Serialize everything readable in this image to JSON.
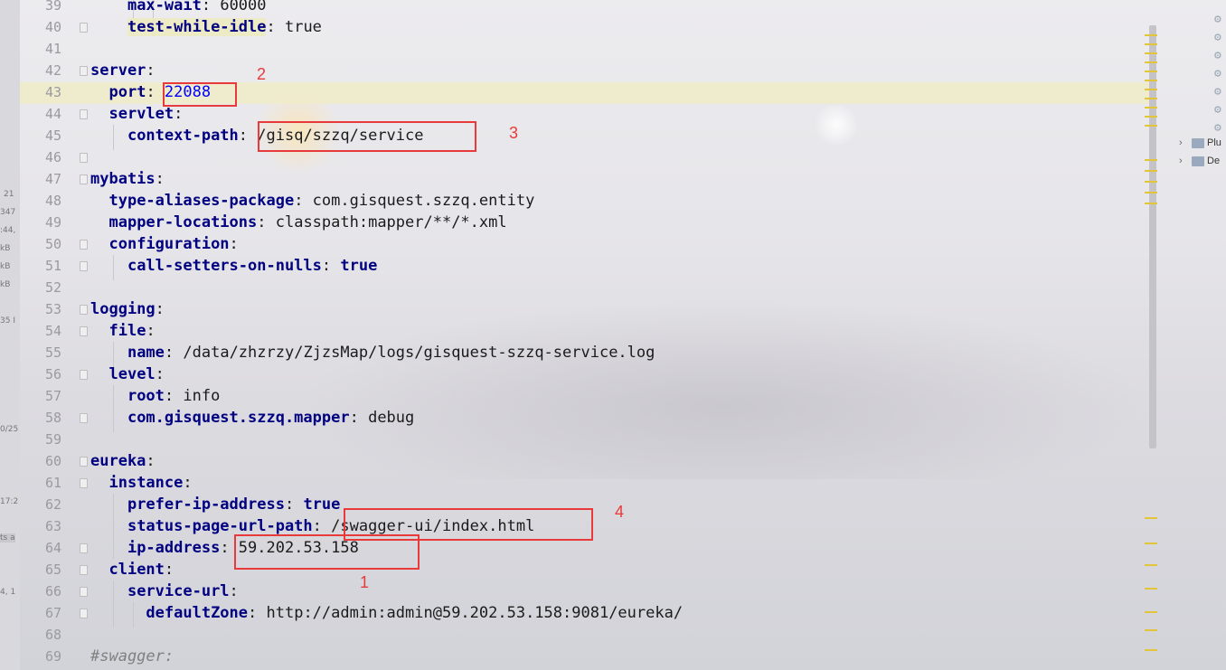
{
  "editor": {
    "line_numbers": [
      "39",
      "40",
      "41",
      "42",
      "43",
      "44",
      "45",
      "46",
      "47",
      "48",
      "49",
      "50",
      "51",
      "52",
      "53",
      "54",
      "55",
      "56",
      "57",
      "58",
      "59",
      "60",
      "61",
      "62",
      "63",
      "64",
      "65",
      "66",
      "67",
      "68",
      "69"
    ],
    "code_lines": [
      {
        "indent": "    ",
        "key": "max-wait",
        "sep": ": ",
        "value": "60000"
      },
      {
        "indent": "    ",
        "key": "test-while-idle",
        "sep": ": ",
        "value": "true"
      },
      {
        "indent": "",
        "key": "",
        "sep": "",
        "value": ""
      },
      {
        "indent": "",
        "key": "server",
        "sep": ":",
        "value": ""
      },
      {
        "indent": "  ",
        "key": "port",
        "sep": ": ",
        "value": "22088"
      },
      {
        "indent": "  ",
        "key": "servlet",
        "sep": ":",
        "value": ""
      },
      {
        "indent": "    ",
        "key": "context-path",
        "sep": ": ",
        "value": "/gisq/szzq/service"
      },
      {
        "indent": "",
        "key": "",
        "sep": "",
        "value": ""
      },
      {
        "indent": "",
        "key": "mybatis",
        "sep": ":",
        "value": ""
      },
      {
        "indent": "  ",
        "key": "type-aliases-package",
        "sep": ": ",
        "value": "com.gisquest.szzq.entity"
      },
      {
        "indent": "  ",
        "key": "mapper-locations",
        "sep": ": ",
        "value": "classpath:mapper/**/*.xml"
      },
      {
        "indent": "  ",
        "key": "configuration",
        "sep": ":",
        "value": ""
      },
      {
        "indent": "    ",
        "key": "call-setters-on-nulls",
        "sep": ": ",
        "value": "true"
      },
      {
        "indent": "",
        "key": "",
        "sep": "",
        "value": ""
      },
      {
        "indent": "",
        "key": "logging",
        "sep": ":",
        "value": ""
      },
      {
        "indent": "  ",
        "key": "file",
        "sep": ":",
        "value": ""
      },
      {
        "indent": "    ",
        "key": "name",
        "sep": ": ",
        "value": "/data/zhzrzy/ZjzsMap/logs/gisquest-szzq-service.log"
      },
      {
        "indent": "  ",
        "key": "level",
        "sep": ":",
        "value": ""
      },
      {
        "indent": "    ",
        "key": "root",
        "sep": ": ",
        "value": "info"
      },
      {
        "indent": "    ",
        "key": "com.gisquest.szzq.mapper",
        "sep": ": ",
        "value": "debug"
      },
      {
        "indent": "",
        "key": "",
        "sep": "",
        "value": ""
      },
      {
        "indent": "",
        "key": "eureka",
        "sep": ":",
        "value": ""
      },
      {
        "indent": "  ",
        "key": "instance",
        "sep": ":",
        "value": ""
      },
      {
        "indent": "    ",
        "key": "prefer-ip-address",
        "sep": ": ",
        "value": "true"
      },
      {
        "indent": "    ",
        "key": "status-page-url-path",
        "sep": ": ",
        "value": "/swagger-ui/index.html"
      },
      {
        "indent": "    ",
        "key": "ip-address",
        "sep": ": ",
        "value": "59.202.53.158"
      },
      {
        "indent": "  ",
        "key": "client",
        "sep": ":",
        "value": ""
      },
      {
        "indent": "    ",
        "key": "service-url",
        "sep": ":",
        "value": ""
      },
      {
        "indent": "      ",
        "key": "defaultZone",
        "sep": ": ",
        "value": "http://admin:admin@59.202.53.158:9081/eureka/"
      },
      {
        "indent": "",
        "key": "",
        "sep": "",
        "value": ""
      },
      {
        "indent": "",
        "key": "",
        "sep": "",
        "value": "",
        "comment": "#swagger:"
      }
    ],
    "caret_line": "43"
  },
  "annotations": [
    {
      "label": "2"
    },
    {
      "label": "3"
    },
    {
      "label": "4"
    },
    {
      "label": "1"
    }
  ],
  "left_strip_values": [
    "21",
    "347",
    ":44,",
    "kB",
    "kB",
    "kB",
    "35 I",
    "0/25",
    "17:2",
    "ts a",
    "4, 1"
  ],
  "right_panel": {
    "tree_items": [
      {
        "label": "Plu"
      },
      {
        "label": "De"
      }
    ]
  },
  "colors": {
    "key": "#000080",
    "number": "#0000ff",
    "annotation": "#e83a3a",
    "caret_line": "#f0ecc4"
  }
}
